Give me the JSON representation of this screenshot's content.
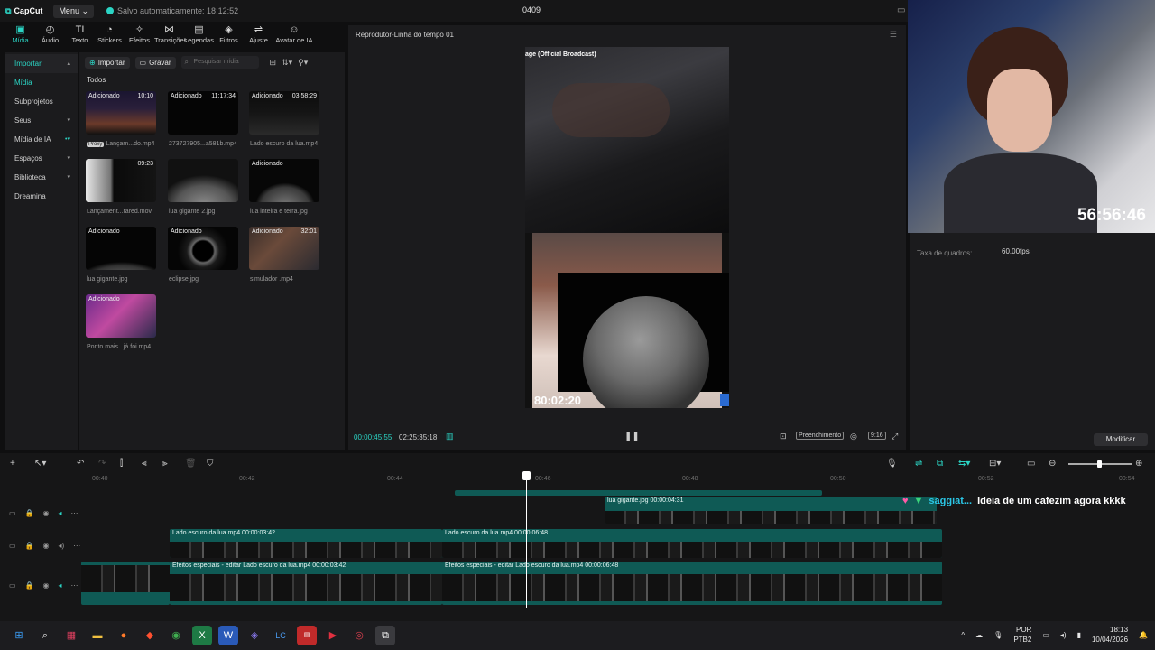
{
  "app": {
    "logo": "CapCut",
    "menu_label": "Menu",
    "autosave": "Salvo automaticamente: 18:12:52",
    "project_name": "0409"
  },
  "tools": [
    {
      "label": "Mídia",
      "icon": "media-icon"
    },
    {
      "label": "Áudio",
      "icon": "audio-icon"
    },
    {
      "label": "Texto",
      "icon": "text-icon"
    },
    {
      "label": "Stickers",
      "icon": "sticker-icon"
    },
    {
      "label": "Efeitos",
      "icon": "effects-icon"
    },
    {
      "label": "Transições",
      "icon": "transitions-icon"
    },
    {
      "label": "Legendas",
      "icon": "captions-icon"
    },
    {
      "label": "Filtros",
      "icon": "filters-icon"
    },
    {
      "label": "Ajuste",
      "icon": "adjust-icon"
    },
    {
      "label": "Avatar de IA",
      "icon": "avatar-icon"
    }
  ],
  "leftnav": {
    "import": "Importar",
    "items": [
      "Mídia",
      "Subprojetos",
      "Seus",
      "Mídia de IA",
      "Espaços",
      "Biblioteca",
      "Dreamina"
    ]
  },
  "media": {
    "import_btn": "Importar",
    "record_btn": "Gravar",
    "search_placeholder": "Pesquisar mídia",
    "section": "Todos",
    "tiles": [
      {
        "badge": "Adicionado",
        "duration": "10:10",
        "name": "Lançam...do.mp4",
        "proxy": "Proxy"
      },
      {
        "badge": "Adicionado",
        "duration": "11:17:34",
        "name": "273727905...a581b.mp4"
      },
      {
        "badge": "Adicionado",
        "duration": "03:58:29",
        "name": "Lado escuro da lua.mp4"
      },
      {
        "badge": "",
        "duration": "09:23",
        "name": "Lançament...rared.mov"
      },
      {
        "badge": "",
        "duration": "",
        "name": "lua gigante 2.jpg"
      },
      {
        "badge": "Adicionado",
        "duration": "",
        "name": "lua inteira e terra.jpg"
      },
      {
        "badge": "Adicionado",
        "duration": "",
        "name": "lua gigante.jpg"
      },
      {
        "badge": "Adicionado",
        "duration": "",
        "name": "eclipse.jpg"
      },
      {
        "badge": "Adicionado",
        "duration": "32:01",
        "name": "simulador .mp4"
      },
      {
        "badge": "Adicionado",
        "duration": "",
        "name": "Ponto mais...já foi.mp4"
      }
    ]
  },
  "player": {
    "title": "Reprodutor-Linha do tempo 01",
    "video_caption": "age (Official Broadcast)",
    "overlay_time": "80:02:20",
    "current_time": "00:00:45:55",
    "total_time": "02:25:35:18",
    "fill_label": "Preenchimento",
    "ratio_label": "9:16"
  },
  "properties": {
    "frame_rate_label": "Taxa de quadros:",
    "frame_rate_value": "60.00fps",
    "modify_btn": "Modificar"
  },
  "webcam": {
    "timer": "56:56:46"
  },
  "timeline": {
    "ticks": [
      "00:40",
      "00:42",
      "00:44",
      "00:46",
      "00:48",
      "00:50",
      "00:52",
      "00:54"
    ],
    "clips": [
      {
        "label": "lua gigante.jpg   00:00:04:31"
      },
      {
        "label": "Lado escuro da lua.mp4   00:00:03:42"
      },
      {
        "label": "Lado escuro da lua.mp4   00:00:06:48"
      },
      {
        "label": "Efeitos especiais - editar   Lado escuro da lua.mp4   00:00:03:42"
      },
      {
        "label": "Efeitos especiais - editar   Lado escuro da lua.mp4   00:00:06:48"
      }
    ],
    "chat_user": "saggiat...",
    "chat_message": "Ideia de um cafezim agora kkkk"
  },
  "taskbar": {
    "lang": "POR",
    "layout": "PTB2",
    "time": "18:13",
    "date": "10/04/2026"
  },
  "colors": {
    "accent": "#2bd4c4",
    "clip": "#0f5a55",
    "bg": "#1b1b1d"
  }
}
